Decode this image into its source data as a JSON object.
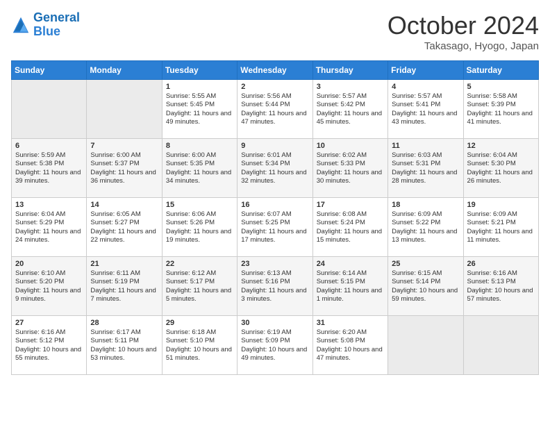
{
  "header": {
    "logo_line1": "General",
    "logo_line2": "Blue",
    "month": "October 2024",
    "location": "Takasago, Hyogo, Japan"
  },
  "columns": [
    "Sunday",
    "Monday",
    "Tuesday",
    "Wednesday",
    "Thursday",
    "Friday",
    "Saturday"
  ],
  "weeks": [
    [
      {
        "day": "",
        "text": ""
      },
      {
        "day": "",
        "text": ""
      },
      {
        "day": "1",
        "text": "Sunrise: 5:55 AM\nSunset: 5:45 PM\nDaylight: 11 hours and 49 minutes."
      },
      {
        "day": "2",
        "text": "Sunrise: 5:56 AM\nSunset: 5:44 PM\nDaylight: 11 hours and 47 minutes."
      },
      {
        "day": "3",
        "text": "Sunrise: 5:57 AM\nSunset: 5:42 PM\nDaylight: 11 hours and 45 minutes."
      },
      {
        "day": "4",
        "text": "Sunrise: 5:57 AM\nSunset: 5:41 PM\nDaylight: 11 hours and 43 minutes."
      },
      {
        "day": "5",
        "text": "Sunrise: 5:58 AM\nSunset: 5:39 PM\nDaylight: 11 hours and 41 minutes."
      }
    ],
    [
      {
        "day": "6",
        "text": "Sunrise: 5:59 AM\nSunset: 5:38 PM\nDaylight: 11 hours and 39 minutes."
      },
      {
        "day": "7",
        "text": "Sunrise: 6:00 AM\nSunset: 5:37 PM\nDaylight: 11 hours and 36 minutes."
      },
      {
        "day": "8",
        "text": "Sunrise: 6:00 AM\nSunset: 5:35 PM\nDaylight: 11 hours and 34 minutes."
      },
      {
        "day": "9",
        "text": "Sunrise: 6:01 AM\nSunset: 5:34 PM\nDaylight: 11 hours and 32 minutes."
      },
      {
        "day": "10",
        "text": "Sunrise: 6:02 AM\nSunset: 5:33 PM\nDaylight: 11 hours and 30 minutes."
      },
      {
        "day": "11",
        "text": "Sunrise: 6:03 AM\nSunset: 5:31 PM\nDaylight: 11 hours and 28 minutes."
      },
      {
        "day": "12",
        "text": "Sunrise: 6:04 AM\nSunset: 5:30 PM\nDaylight: 11 hours and 26 minutes."
      }
    ],
    [
      {
        "day": "13",
        "text": "Sunrise: 6:04 AM\nSunset: 5:29 PM\nDaylight: 11 hours and 24 minutes."
      },
      {
        "day": "14",
        "text": "Sunrise: 6:05 AM\nSunset: 5:27 PM\nDaylight: 11 hours and 22 minutes."
      },
      {
        "day": "15",
        "text": "Sunrise: 6:06 AM\nSunset: 5:26 PM\nDaylight: 11 hours and 19 minutes."
      },
      {
        "day": "16",
        "text": "Sunrise: 6:07 AM\nSunset: 5:25 PM\nDaylight: 11 hours and 17 minutes."
      },
      {
        "day": "17",
        "text": "Sunrise: 6:08 AM\nSunset: 5:24 PM\nDaylight: 11 hours and 15 minutes."
      },
      {
        "day": "18",
        "text": "Sunrise: 6:09 AM\nSunset: 5:22 PM\nDaylight: 11 hours and 13 minutes."
      },
      {
        "day": "19",
        "text": "Sunrise: 6:09 AM\nSunset: 5:21 PM\nDaylight: 11 hours and 11 minutes."
      }
    ],
    [
      {
        "day": "20",
        "text": "Sunrise: 6:10 AM\nSunset: 5:20 PM\nDaylight: 11 hours and 9 minutes."
      },
      {
        "day": "21",
        "text": "Sunrise: 6:11 AM\nSunset: 5:19 PM\nDaylight: 11 hours and 7 minutes."
      },
      {
        "day": "22",
        "text": "Sunrise: 6:12 AM\nSunset: 5:17 PM\nDaylight: 11 hours and 5 minutes."
      },
      {
        "day": "23",
        "text": "Sunrise: 6:13 AM\nSunset: 5:16 PM\nDaylight: 11 hours and 3 minutes."
      },
      {
        "day": "24",
        "text": "Sunrise: 6:14 AM\nSunset: 5:15 PM\nDaylight: 11 hours and 1 minute."
      },
      {
        "day": "25",
        "text": "Sunrise: 6:15 AM\nSunset: 5:14 PM\nDaylight: 10 hours and 59 minutes."
      },
      {
        "day": "26",
        "text": "Sunrise: 6:16 AM\nSunset: 5:13 PM\nDaylight: 10 hours and 57 minutes."
      }
    ],
    [
      {
        "day": "27",
        "text": "Sunrise: 6:16 AM\nSunset: 5:12 PM\nDaylight: 10 hours and 55 minutes."
      },
      {
        "day": "28",
        "text": "Sunrise: 6:17 AM\nSunset: 5:11 PM\nDaylight: 10 hours and 53 minutes."
      },
      {
        "day": "29",
        "text": "Sunrise: 6:18 AM\nSunset: 5:10 PM\nDaylight: 10 hours and 51 minutes."
      },
      {
        "day": "30",
        "text": "Sunrise: 6:19 AM\nSunset: 5:09 PM\nDaylight: 10 hours and 49 minutes."
      },
      {
        "day": "31",
        "text": "Sunrise: 6:20 AM\nSunset: 5:08 PM\nDaylight: 10 hours and 47 minutes."
      },
      {
        "day": "",
        "text": ""
      },
      {
        "day": "",
        "text": ""
      }
    ]
  ]
}
